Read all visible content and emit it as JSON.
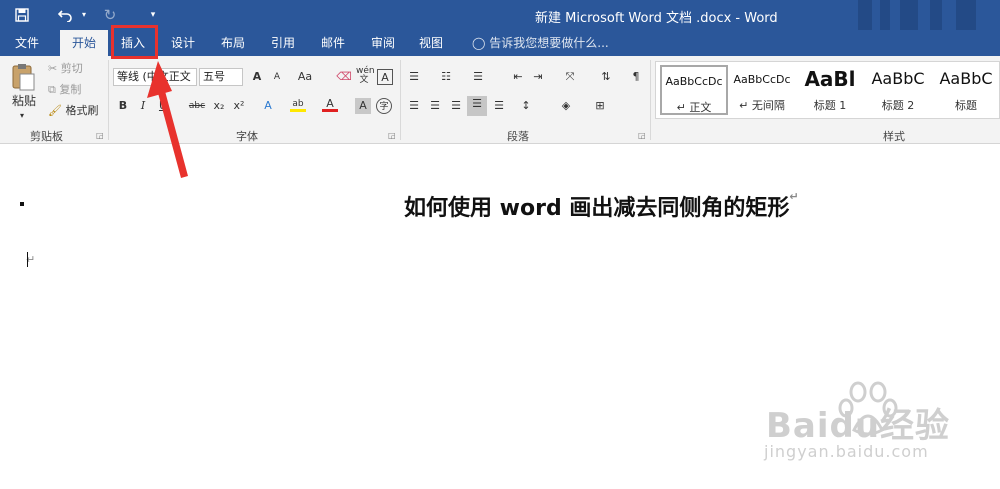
{
  "window": {
    "title": "新建 Microsoft Word 文档 .docx - Word"
  },
  "quick_access": {
    "save_icon": "save-icon",
    "undo_icon": "undo-icon",
    "redo_icon": "redo-icon",
    "customize_icon": "customize-qat-icon"
  },
  "tabs": [
    {
      "label": "文件"
    },
    {
      "label": "开始"
    },
    {
      "label": "插入"
    },
    {
      "label": "设计"
    },
    {
      "label": "布局"
    },
    {
      "label": "引用"
    },
    {
      "label": "邮件"
    },
    {
      "label": "审阅"
    },
    {
      "label": "视图"
    }
  ],
  "tell_me": {
    "placeholder": "告诉我您想要做什么..."
  },
  "clipboard": {
    "paste_label": "粘贴",
    "cut_label": "剪切",
    "copy_label": "复制",
    "format_painter_label": "格式刷",
    "group_label": "剪贴板"
  },
  "font": {
    "font_name": "等线 (中文正文",
    "font_size": "五号",
    "group_label": "字体",
    "grow": "A",
    "shrink": "A",
    "case": "Aa",
    "bold": "B",
    "italic": "I",
    "underline": "U",
    "strike": "abc",
    "subscript": "x₂",
    "superscript": "x²",
    "color": "A"
  },
  "paragraph": {
    "group_label": "段落"
  },
  "styles": {
    "group_label": "样式",
    "items": [
      {
        "preview": "AaBbCcDc",
        "name": "↵ 正文"
      },
      {
        "preview": "AaBbCcDc",
        "name": "↵ 无间隔"
      },
      {
        "preview": "AaBl",
        "name": "标题 1"
      },
      {
        "preview": "AaBbC",
        "name": "标题 2"
      },
      {
        "preview": "AaBbC",
        "name": "标题"
      }
    ]
  },
  "document": {
    "heading": "如何使用 word 画出减去同侧角的矩形"
  },
  "watermark": {
    "brand": "Baidu经验",
    "url": "jingyan.baidu.com"
  },
  "colors": {
    "word_blue": "#2b579a",
    "ribbon_bg": "#f3f3f3",
    "highlight_red": "#e8322d"
  }
}
